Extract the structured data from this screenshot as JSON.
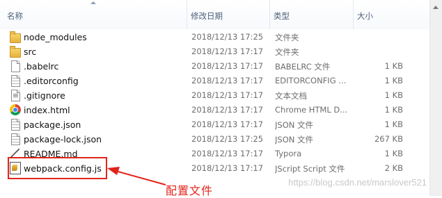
{
  "columns": {
    "name": "名称",
    "date": "修改日期",
    "type": "类型",
    "size": "大小"
  },
  "rows": [
    {
      "name": "node_modules",
      "date": "2018/12/13 17:25",
      "type": "文件夹",
      "size": "",
      "icon": "folder-icon"
    },
    {
      "name": "src",
      "date": "2018/12/13 17:17",
      "type": "文件夹",
      "size": "",
      "icon": "folder-icon"
    },
    {
      "name": ".babelrc",
      "date": "2018/12/13 17:17",
      "type": "BABELRC 文件",
      "size": "1 KB",
      "icon": "blank-file-icon"
    },
    {
      "name": ".editorconfig",
      "date": "2018/12/13 17:17",
      "type": "EDITORCONFIG ...",
      "size": "1 KB",
      "icon": "config-file-icon"
    },
    {
      "name": ".gitignore",
      "date": "2018/12/13 17:17",
      "type": "文本文档",
      "size": "1 KB",
      "icon": "text-file-icon"
    },
    {
      "name": "index.html",
      "date": "2018/12/13 17:17",
      "type": "Chrome HTML D...",
      "size": "1 KB",
      "icon": "chrome-icon"
    },
    {
      "name": "package.json",
      "date": "2018/12/13 17:17",
      "type": "JSON 文件",
      "size": "1 KB",
      "icon": "json-file-icon"
    },
    {
      "name": "package-lock.json",
      "date": "2018/12/13 17:25",
      "type": "JSON 文件",
      "size": "267 KB",
      "icon": "json-file-icon"
    },
    {
      "name": "README.md",
      "date": "2018/12/13 17:17",
      "type": "Typora",
      "size": "1 KB",
      "icon": "markdown-file-icon"
    },
    {
      "name": "webpack.config.js",
      "date": "2018/12/13 17:17",
      "type": "JScript Script 文件",
      "size": "2 KB",
      "icon": "jscript-file-icon"
    }
  ],
  "annotation": {
    "text": "配置文件",
    "color": "#e2231a"
  },
  "watermark": "https://blog.csdn.net/marslover521"
}
